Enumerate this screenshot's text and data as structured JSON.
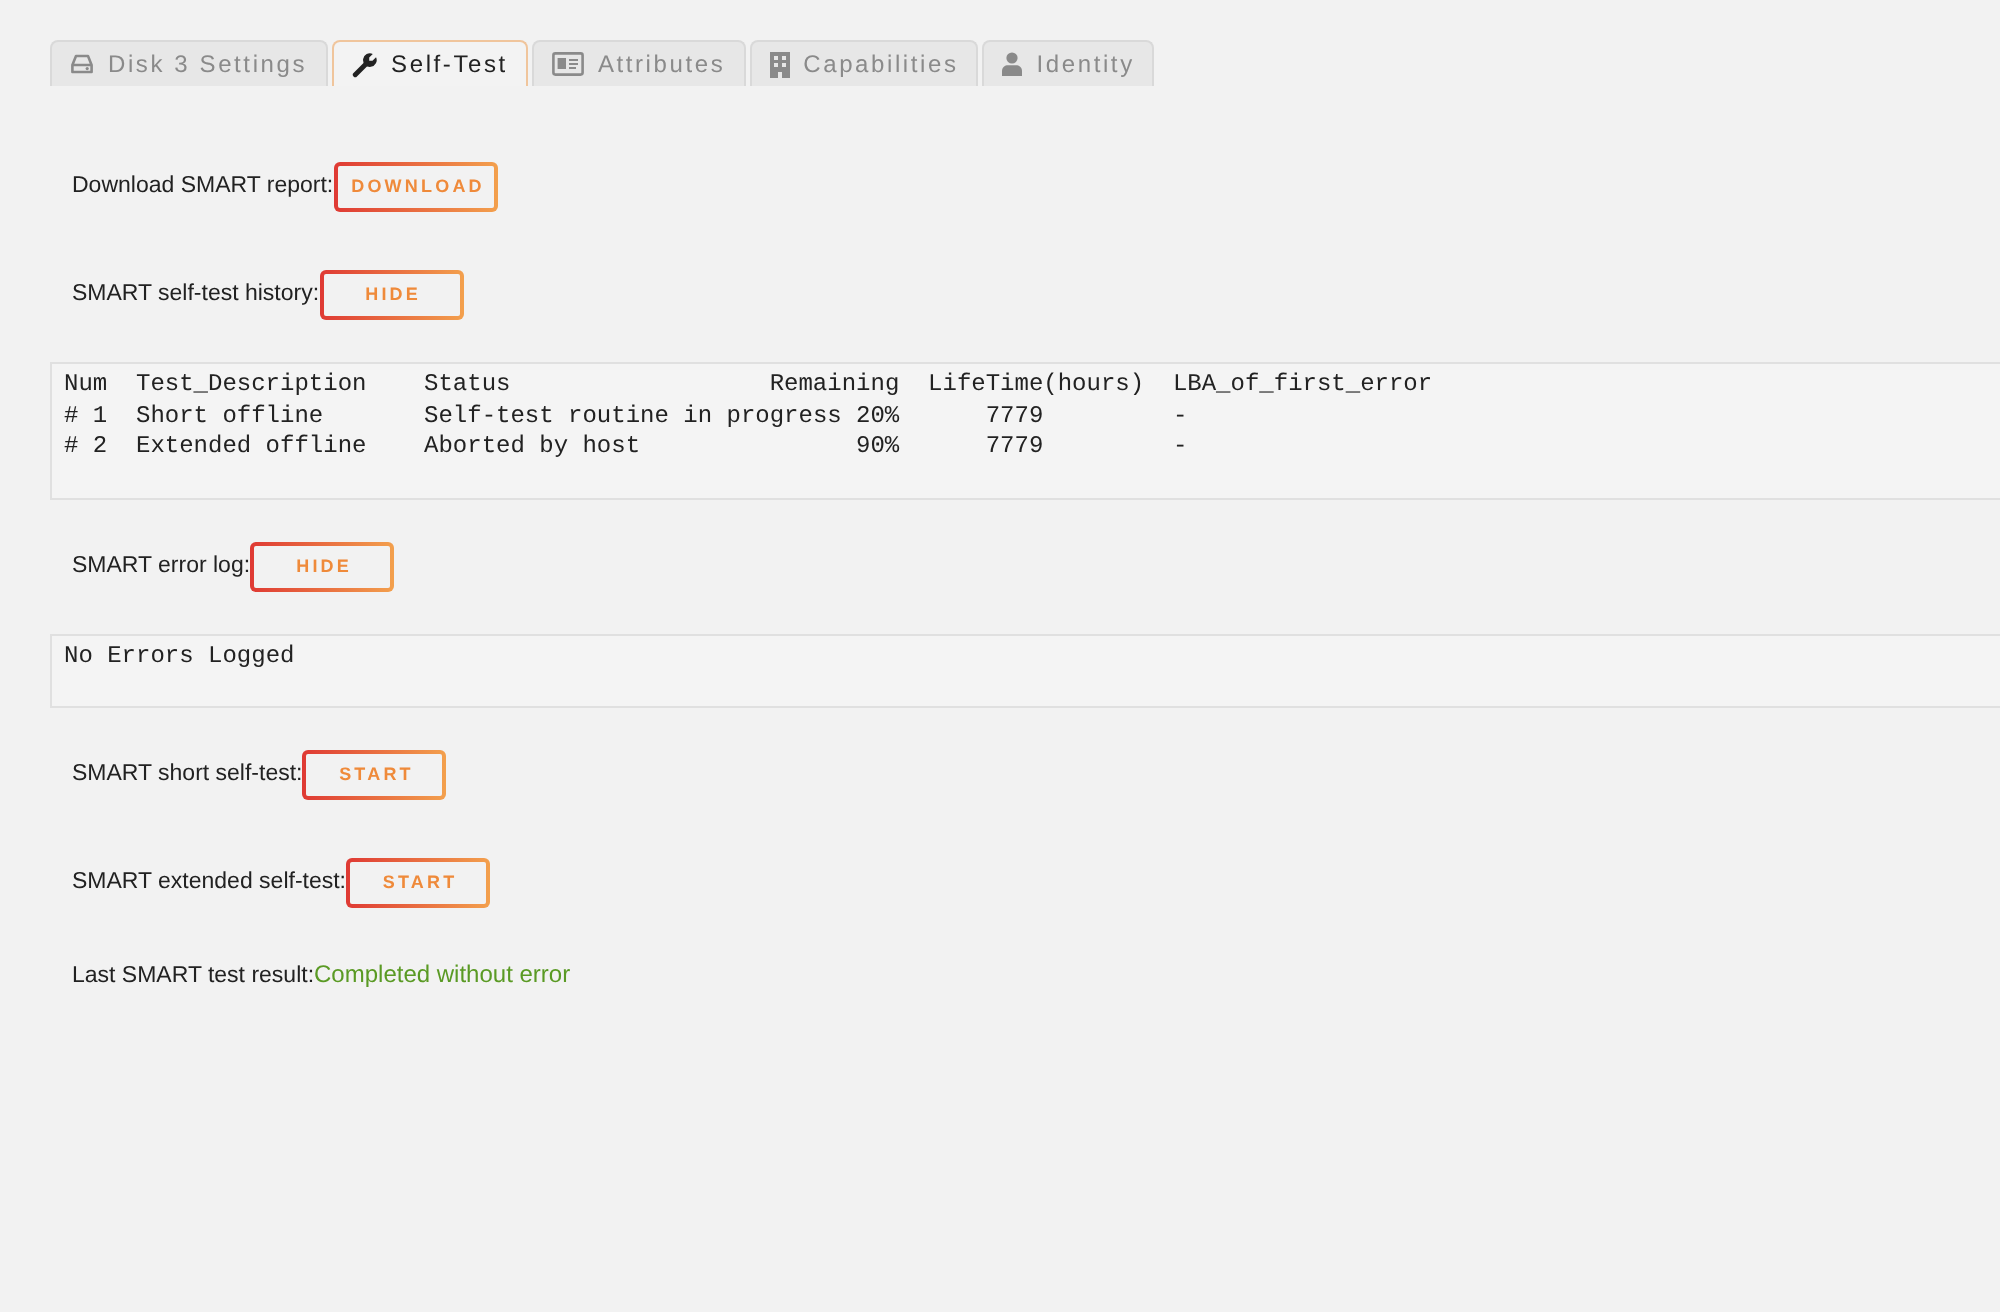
{
  "tabs": [
    {
      "label": "Disk 3 Settings",
      "selected": false
    },
    {
      "label": "Self-Test",
      "selected": true
    },
    {
      "label": "Attributes",
      "selected": false
    },
    {
      "label": "Capabilities",
      "selected": false
    },
    {
      "label": "Identity",
      "selected": false
    }
  ],
  "sections": [
    {
      "kind": "action",
      "label": "Download SMART report:",
      "button": "DOWNLOAD"
    },
    {
      "kind": "action",
      "label": "SMART self-test history:",
      "button": "HIDE"
    },
    {
      "kind": "table",
      "columns": [
        "Num",
        "Test_Description",
        "Status",
        "Remaining",
        "LifeTime(hours)",
        "LBA_of_first_error"
      ],
      "rows": [
        [
          "# 1",
          "Short offline",
          "Self-test routine in progress",
          "20%",
          "7779",
          "-"
        ],
        [
          "# 2",
          "Extended offline",
          "Aborted by host",
          "90%",
          "7779",
          "-"
        ]
      ]
    },
    {
      "kind": "action",
      "label": "SMART error log:",
      "button": "HIDE"
    },
    {
      "kind": "log",
      "text": "No Errors Logged"
    },
    {
      "kind": "action",
      "label": "SMART short self-test:",
      "button": "START"
    },
    {
      "kind": "action",
      "label": "SMART extended self-test:",
      "button": "START"
    },
    {
      "kind": "result",
      "label": "Last SMART test result:",
      "value": "Completed without error"
    }
  ]
}
